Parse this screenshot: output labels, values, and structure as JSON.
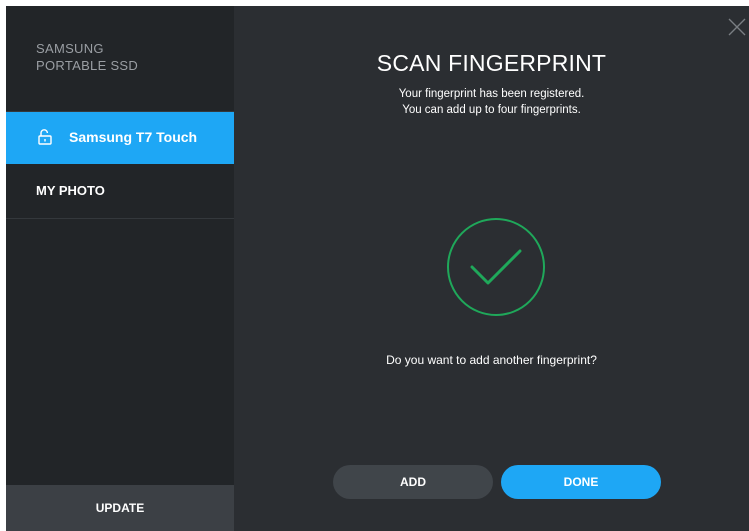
{
  "sidebar": {
    "brand_line1": "SAMSUNG",
    "brand_line2": "PORTABLE SSD",
    "device_label": "Samsung T7 Touch",
    "device_icon": "unlocked-padlock-icon",
    "folder_label": "MY PHOTO",
    "update_label": "UPDATE"
  },
  "main": {
    "title": "SCAN FINGERPRINT",
    "description_line1": "Your fingerprint has been registered.",
    "description_line2": "You can add up to four fingerprints.",
    "status_icon": "checkmark-circle-icon",
    "question": "Do you want to add another fingerprint?",
    "add_label": "ADD",
    "done_label": "DONE"
  },
  "window": {
    "close_icon": "close-icon"
  },
  "colors": {
    "accent": "#1ea7f5",
    "success": "#1fa85a",
    "sidebar_bg": "#222528",
    "main_bg": "#2b2e32",
    "secondary_button": "#40454a"
  }
}
